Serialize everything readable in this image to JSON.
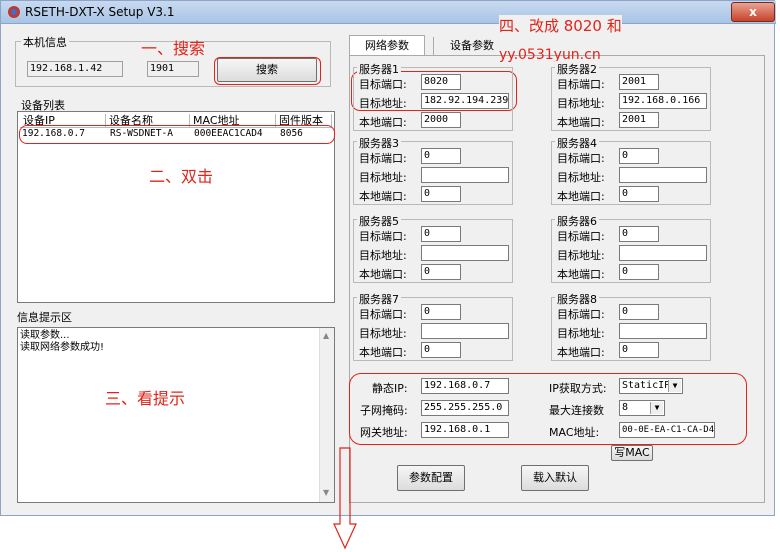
{
  "window": {
    "title": "RSETH-DXT-X Setup V3.1",
    "close_glyph": "x"
  },
  "local": {
    "group_label": "本机信息",
    "ip": "192.168.1.42",
    "port": "1901",
    "search_button": "搜索"
  },
  "devices": {
    "label": "设备列表",
    "columns": [
      "设备IP",
      "设备名称",
      "MAC地址",
      "固件版本"
    ],
    "rows": [
      [
        "192.168.0.7",
        "RS-WSDNET-A",
        "000EEAC1CAD4",
        "8056"
      ]
    ]
  },
  "info": {
    "label": "信息提示区",
    "lines": [
      "读取参数...",
      "读取网络参数成功!"
    ]
  },
  "tabs": {
    "network": "网络参数",
    "device": "设备参数"
  },
  "servers": [
    {
      "label": "服务器1",
      "target_port_label": "目标端口:",
      "target_addr_label": "目标地址:",
      "local_port_label": "本地端口:",
      "target_port": "8020",
      "target_addr": "182.92.194.239",
      "local_port": "2000"
    },
    {
      "label": "服务器2",
      "target_port_label": "目标端口:",
      "target_addr_label": "目标地址:",
      "local_port_label": "本地端口:",
      "target_port": "2001",
      "target_addr": "192.168.0.166",
      "local_port": "2001"
    },
    {
      "label": "服务器3",
      "target_port_label": "目标端口:",
      "target_addr_label": "目标地址:",
      "local_port_label": "本地端口:",
      "target_port": "0",
      "target_addr": "",
      "local_port": "0"
    },
    {
      "label": "服务器4",
      "target_port_label": "目标端口:",
      "target_addr_label": "目标地址:",
      "local_port_label": "本地端口:",
      "target_port": "0",
      "target_addr": "",
      "local_port": "0"
    },
    {
      "label": "服务器5",
      "target_port_label": "目标端口:",
      "target_addr_label": "目标地址:",
      "local_port_label": "本地端口:",
      "target_port": "0",
      "target_addr": "",
      "local_port": "0"
    },
    {
      "label": "服务器6",
      "target_port_label": "目标端口:",
      "target_addr_label": "目标地址:",
      "local_port_label": "本地端口:",
      "target_port": "0",
      "target_addr": "",
      "local_port": "0"
    },
    {
      "label": "服务器7",
      "target_port_label": "目标端口:",
      "target_addr_label": "目标地址:",
      "local_port_label": "本地端口:",
      "target_port": "0",
      "target_addr": "",
      "local_port": "0"
    },
    {
      "label": "服务器8",
      "target_port_label": "目标端口:",
      "target_addr_label": "目标地址:",
      "local_port_label": "本地端口:",
      "target_port": "0",
      "target_addr": "",
      "local_port": "0"
    }
  ],
  "net": {
    "static_ip_label": "静态IP:",
    "static_ip": "192.168.0.7",
    "mask_label": "子网掩码:",
    "mask": "255.255.255.0",
    "gateway_label": "网关地址:",
    "gateway": "192.168.0.1",
    "ip_mode_label": "IP获取方式:",
    "ip_mode": "StaticIP",
    "max_conn_label": "最大连接数",
    "max_conn": "8",
    "mac_label": "MAC地址:",
    "mac": "00-0E-EA-C1-CA-D4"
  },
  "buttons": {
    "write_mac": "写MAC",
    "config": "参数配置",
    "load_default": "载入默认"
  },
  "annotations": {
    "a1": "一、搜索",
    "a2": "二、双击",
    "a3": "三、看提示",
    "a4": "四、改成 8020 和",
    "watermark": "yy.0531yun.cn"
  },
  "colors": {
    "annotation": "#e2231a",
    "selection_border": "#e2231a"
  }
}
